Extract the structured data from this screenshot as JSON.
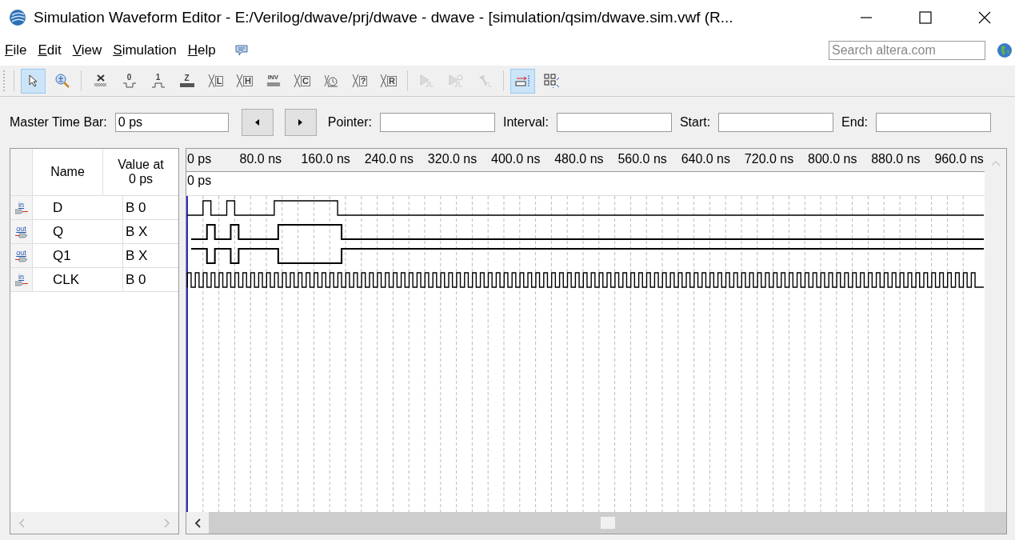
{
  "window": {
    "title": "Simulation Waveform Editor - E:/Verilog/dwave/prj/dwave - dwave - [simulation/qsim/dwave.sim.vwf (R..."
  },
  "menu": [
    "File",
    "Edit",
    "View",
    "Simulation",
    "Help"
  ],
  "search": {
    "placeholder": "Search altera.com"
  },
  "toolbar": [
    [
      {
        "kind": "pointer",
        "selected": true,
        "disabled": false
      },
      {
        "kind": "zoom",
        "selected": false,
        "disabled": false
      }
    ],
    [
      {
        "kind": "unknown",
        "selected": false,
        "disabled": false
      },
      {
        "kind": "low",
        "text": "0",
        "selected": false,
        "disabled": false
      },
      {
        "kind": "high",
        "text": "1",
        "selected": false,
        "disabled": false
      },
      {
        "kind": "bar",
        "text": "Z",
        "selected": false,
        "disabled": false
      },
      {
        "kind": "transition",
        "text": "L",
        "selected": false,
        "disabled": false
      },
      {
        "kind": "transition",
        "text": "H",
        "selected": false,
        "disabled": false
      },
      {
        "kind": "invert",
        "text": "INV",
        "selected": false,
        "disabled": false
      },
      {
        "kind": "transition",
        "text": "C",
        "selected": false,
        "disabled": false
      },
      {
        "kind": "clock",
        "selected": false,
        "disabled": false
      },
      {
        "kind": "transition",
        "text": "?",
        "selected": false,
        "disabled": false
      },
      {
        "kind": "transition",
        "text": "R",
        "selected": false,
        "disabled": false
      }
    ],
    [
      {
        "kind": "run",
        "selected": false,
        "disabled": true
      },
      {
        "kind": "run-timer",
        "selected": false,
        "disabled": true
      },
      {
        "kind": "hammer",
        "selected": false,
        "disabled": true
      }
    ],
    [
      {
        "kind": "snap",
        "selected": true,
        "disabled": false
      },
      {
        "kind": "grid",
        "selected": false,
        "disabled": false
      }
    ]
  ],
  "time_bar": {
    "master_label": "Master Time Bar:",
    "master_value": "0 ps",
    "fields": [
      {
        "label": "Pointer:"
      },
      {
        "label": "Interval:"
      },
      {
        "label": "Start:"
      },
      {
        "label": "End:"
      }
    ]
  },
  "signal_table": {
    "columns": [
      "Name",
      "Value at 0 ps"
    ],
    "rows": [
      {
        "kind": "input",
        "port": "in",
        "name": "D",
        "value": "B 0"
      },
      {
        "kind": "output",
        "port": "out",
        "name": "Q",
        "value": "B X"
      },
      {
        "kind": "output",
        "port": "out",
        "name": "Q1",
        "value": "B X"
      },
      {
        "kind": "input",
        "port": "in",
        "name": "CLK",
        "value": "B 0"
      }
    ]
  },
  "waveform": {
    "ruler": [
      "0 ps",
      "80.0 ns",
      "160.0 ns",
      "240.0 ns",
      "320.0 ns",
      "400.0 ns",
      "480.0 ns",
      "560.0 ns",
      "640.0 ns",
      "720.0 ns",
      "800.0 ns",
      "880.0 ns",
      "960.0 ns"
    ],
    "cursor_time": "0 ps"
  }
}
